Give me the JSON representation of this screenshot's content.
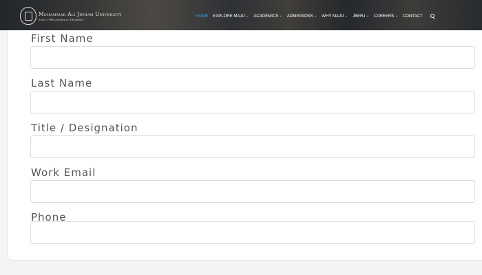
{
  "header": {
    "logo_name": "Mohammad Ali Jinnah University",
    "logo_tagline": "Since 1998 Leading in Education",
    "nav": [
      {
        "label": "HOME",
        "active": true,
        "has_dropdown": false
      },
      {
        "label": "EXPLORE MAJU",
        "active": false,
        "has_dropdown": true
      },
      {
        "label": "ACADEMICS",
        "active": false,
        "has_dropdown": true
      },
      {
        "label": "ADMISSIONS",
        "active": false,
        "has_dropdown": true
      },
      {
        "label": "WHY MAJU",
        "active": false,
        "has_dropdown": true
      },
      {
        "label": "JBERJ",
        "active": false,
        "has_dropdown": true
      },
      {
        "label": "CAREERS",
        "active": false,
        "has_dropdown": true
      },
      {
        "label": "CONTACT",
        "active": false,
        "has_dropdown": false
      }
    ],
    "search_icon": "search-icon",
    "active_color": "#29a3d9"
  },
  "form": {
    "fields": [
      {
        "label": "First Name",
        "value": "",
        "placeholder": ""
      },
      {
        "label": "Last Name",
        "value": "",
        "placeholder": ""
      },
      {
        "label": "Title / Designation",
        "value": "",
        "placeholder": ""
      },
      {
        "label": "Work Email",
        "value": "",
        "placeholder": ""
      },
      {
        "label": "Phone",
        "value": "",
        "placeholder": ""
      }
    ]
  }
}
